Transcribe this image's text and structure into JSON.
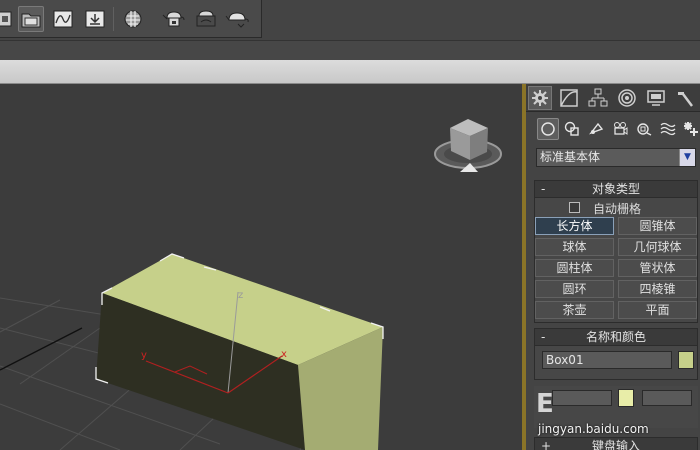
{
  "toolbar": {
    "icons": [
      "document-icon",
      "folder-icon",
      "graph-editor-icon",
      "render-setup-icon",
      "material-editor-icon",
      "teapot-render-icon",
      "teapot-frame-icon",
      "teapot-active-icon"
    ]
  },
  "viewport": {
    "axis_x": "x",
    "axis_y": "y",
    "axis_z": "z",
    "box_color": "#c6d08a"
  },
  "panel": {
    "tabs": [
      "create-tab",
      "modify-tab",
      "hierarchy-tab",
      "motion-tab",
      "display-tab",
      "utilities-tab"
    ],
    "categories": [
      "geometry",
      "shapes",
      "lights",
      "cameras",
      "helpers",
      "space-warps",
      "systems"
    ],
    "dropdown_value": "标准基本体",
    "object_type": {
      "title": "对象类型",
      "collapse": "-",
      "autogrid_label": "自动栅格",
      "buttons": [
        "长方体",
        "圆锥体",
        "球体",
        "几何球体",
        "圆柱体",
        "管状体",
        "圆环",
        "四棱锥",
        "茶壶",
        "平面"
      ],
      "active_index": 0
    },
    "name_color": {
      "title": "名称和颜色",
      "collapse": "-",
      "name_value": "Box01",
      "color": "#c6d08a"
    },
    "keyboard": {
      "title": "键盘输入",
      "collapse": "+"
    }
  },
  "watermark": {
    "text": "jingyan.baidu.com"
  }
}
